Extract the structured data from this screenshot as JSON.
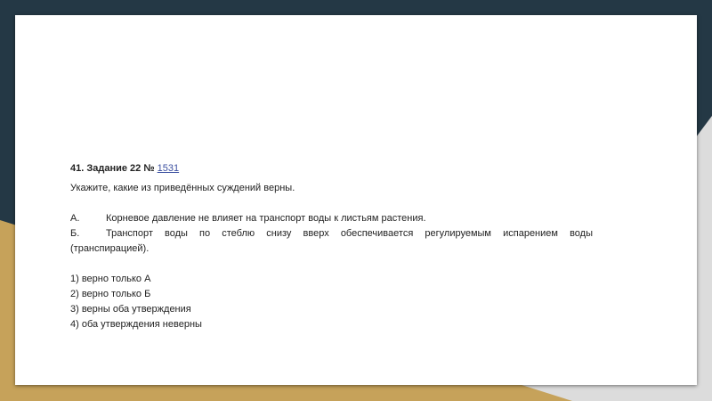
{
  "colors": {
    "dark": "#243845",
    "gold": "#c6a25a",
    "grey": "#dcdcdc"
  },
  "task": {
    "title_prefix": "41. Задание 22 № ",
    "task_link": "1531",
    "prompt": "Укажите, какие из приведённых суждений верны.",
    "statements": [
      {
        "label": "А.",
        "text": "Корневое давление не влияет на транспорт воды к листьям растения."
      },
      {
        "label": "Б.",
        "text": "Транспорт воды по стеблю снизу вверх обеспечивается регулируемым испарением воды (транспирацией)."
      }
    ],
    "options": [
      "1) верно только А",
      "2) верно только Б",
      "3) верны оба утверждения",
      "4) оба утверждения неверны"
    ]
  }
}
